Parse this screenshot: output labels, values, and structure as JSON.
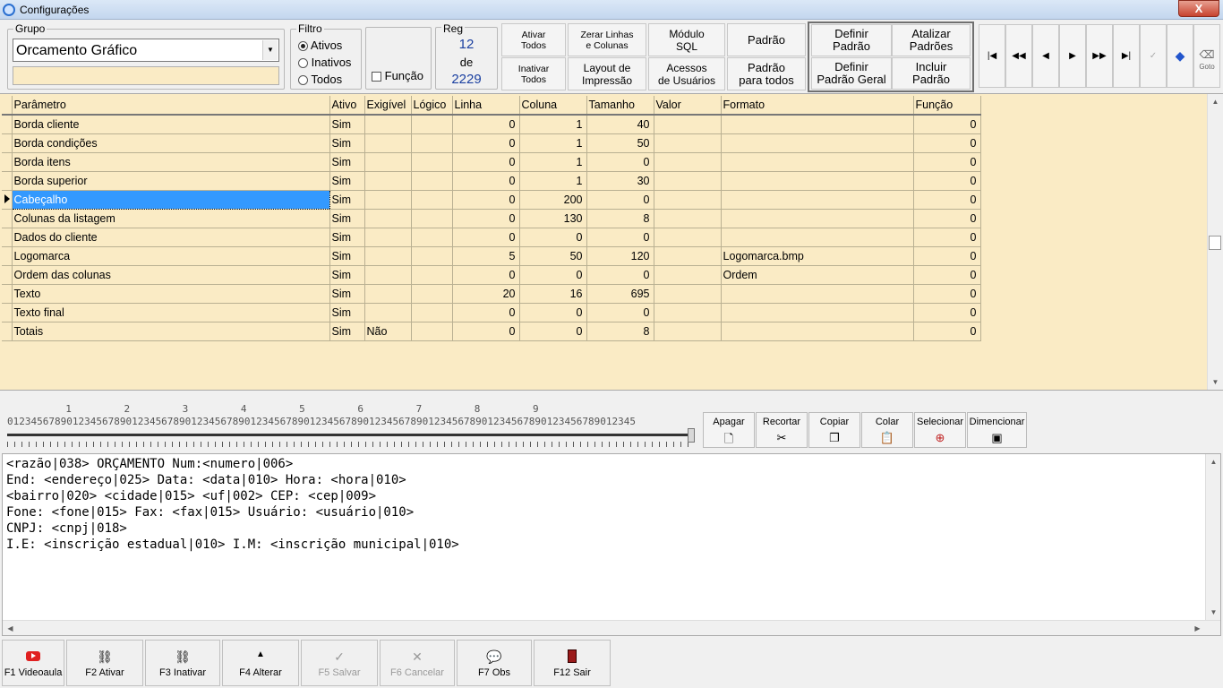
{
  "window": {
    "title": "Configurações",
    "close_label": "X"
  },
  "grupo": {
    "label": "Grupo",
    "value": "Orcamento Gráfico",
    "second_value": ""
  },
  "filtro": {
    "label": "Filtro",
    "options": [
      "Ativos",
      "Inativos",
      "Todos"
    ],
    "selected": "Ativos"
  },
  "funcao_check": {
    "label": "Função"
  },
  "reg": {
    "label": "Reg",
    "current": "12",
    "of": "de",
    "total": "2229"
  },
  "buttons": {
    "ativar_todos": [
      "Ativar",
      "Todos"
    ],
    "inativar_todos": [
      "Inativar",
      "Todos"
    ],
    "zerar": [
      "Zerar Linhas",
      "e Colunas"
    ],
    "layout": [
      "Layout de",
      "Impressão"
    ],
    "modulo_sql": [
      "Módulo",
      "SQL"
    ],
    "acessos": [
      "Acessos",
      "de Usuários"
    ],
    "padrao": [
      "Padrão"
    ],
    "padrao_todos": [
      "Padrão",
      "para todos"
    ],
    "definir_padrao": [
      "Definir",
      "Padrão"
    ],
    "atualizar_padroes": [
      "Atalizar",
      "Padrões"
    ],
    "definir_padrao_geral": [
      "Definir",
      "Padrão Geral"
    ],
    "incluir_padrao": [
      "Incluir",
      "Padrão"
    ]
  },
  "nav": [
    "first",
    "prev-page",
    "prev",
    "next",
    "next-page",
    "last",
    "confirm",
    "bookmark",
    "goto"
  ],
  "nav_goto_label": "Goto",
  "grid": {
    "columns": [
      "Parâmetro",
      "Ativo",
      "Exigível",
      "Lógico",
      "Linha",
      "Coluna",
      "Tamanho",
      "Valor",
      "Formato",
      "Função"
    ],
    "rows": [
      [
        "Borda cliente",
        "Sim",
        "",
        "",
        "0",
        "1",
        "40",
        "",
        "",
        "0"
      ],
      [
        "Borda condições",
        "Sim",
        "",
        "",
        "0",
        "1",
        "50",
        "",
        "",
        "0"
      ],
      [
        "Borda itens",
        "Sim",
        "",
        "",
        "0",
        "1",
        "0",
        "",
        "",
        "0"
      ],
      [
        "Borda superior",
        "Sim",
        "",
        "",
        "0",
        "1",
        "30",
        "",
        "",
        "0"
      ],
      [
        "Cabeçalho",
        "Sim",
        "",
        "",
        "0",
        "200",
        "0",
        "",
        "",
        "0"
      ],
      [
        "Colunas da listagem",
        "Sim",
        "",
        "",
        "0",
        "130",
        "8",
        "",
        "",
        "0"
      ],
      [
        "Dados do cliente",
        "Sim",
        "",
        "",
        "0",
        "0",
        "0",
        "",
        "",
        "0"
      ],
      [
        "Logomarca",
        "Sim",
        "",
        "",
        "5",
        "50",
        "120",
        "",
        "Logomarca.bmp",
        "0"
      ],
      [
        "Ordem das colunas",
        "Sim",
        "",
        "",
        "0",
        "0",
        "0",
        "",
        "Ordem",
        "0"
      ],
      [
        "Texto",
        "Sim",
        "",
        "",
        "20",
        "16",
        "695",
        "",
        "",
        "0"
      ],
      [
        "Texto final",
        "Sim",
        "",
        "",
        "0",
        "0",
        "0",
        "",
        "",
        "0"
      ],
      [
        "Totais",
        "Sim",
        "Não",
        "",
        "0",
        "0",
        "8",
        "",
        "",
        "0"
      ]
    ],
    "selected_row": 4
  },
  "ruler": {
    "tens": "          1         2         3         4         5         6         7         8         9",
    "units": "0123456789012345678901234567890123456789012345678901234567890123456789012345678901234567890123456789012345"
  },
  "edit_tools": [
    "Apagar",
    "Recortar",
    "Copiar",
    "Colar",
    "Selecionar",
    "Dimencionar"
  ],
  "editor_text": "<razão|038> ORÇAMENTO Num:<numero|006>\nEnd: <endereço|025> Data: <data|010> Hora: <hora|010>\n<bairro|020> <cidade|015> <uf|002> CEP: <cep|009>\nFone: <fone|015> Fax: <fax|015> Usuário: <usuário|010>\nCNPJ: <cnpj|018>\nI.E: <inscrição estadual|010> I.M: <inscrição municipal|010>",
  "bottom": [
    {
      "label": "F1 Videoaula",
      "icon": "youtube-icon",
      "enabled": true
    },
    {
      "label": "F2 Ativar",
      "icon": "link-icon",
      "enabled": true
    },
    {
      "label": "F3 Inativar",
      "icon": "unlink-icon",
      "enabled": true
    },
    {
      "label": "F4 Alterar",
      "icon": "up-arrow-icon",
      "enabled": true
    },
    {
      "label": "F5 Salvar",
      "icon": "check-icon",
      "enabled": false
    },
    {
      "label": "F6 Cancelar",
      "icon": "x-icon",
      "enabled": false
    },
    {
      "label": "F7 Obs",
      "icon": "speech-bubble-icon",
      "enabled": true
    },
    {
      "label": "F12 Sair",
      "icon": "exit-door-icon",
      "enabled": true
    }
  ],
  "colors": {
    "grid_bg": "#faebc5",
    "selection": "#3399ff",
    "reg_value": "#1a3fa0"
  }
}
